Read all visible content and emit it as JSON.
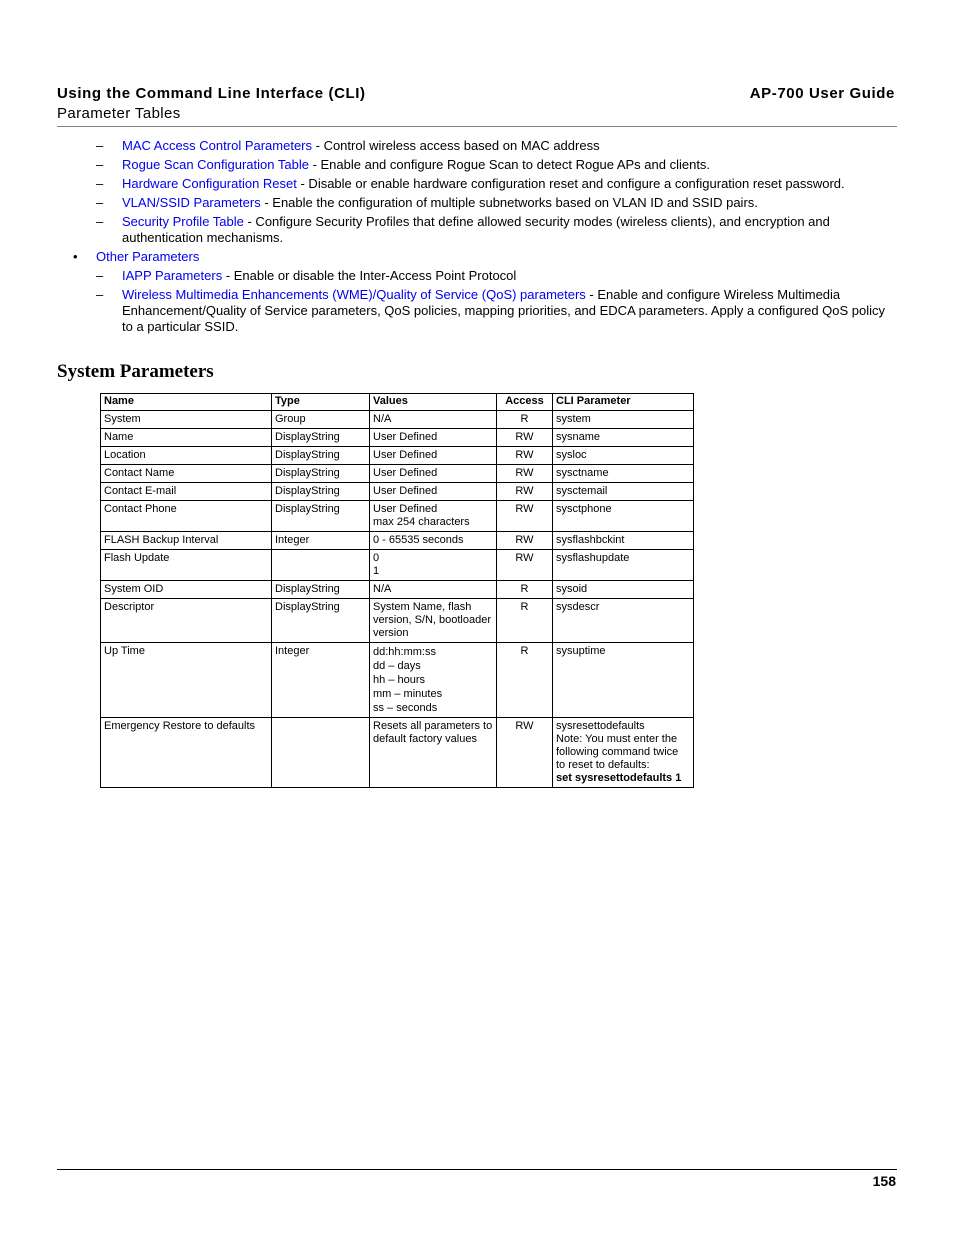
{
  "header": {
    "chapter_title": "Using the Command Line Interface (CLI)",
    "section": "Parameter Tables",
    "guide_title": "AP-700 User Guide"
  },
  "bullets": [
    {
      "marker": "–",
      "kind": "dash",
      "link": "MAC Access Control Parameters",
      "text": " - Control wireless access based on MAC address"
    },
    {
      "marker": "–",
      "kind": "dash",
      "link": "Rogue Scan Configuration Table",
      "text": " - Enable and configure Rogue Scan to detect Rogue APs and clients."
    },
    {
      "marker": "–",
      "kind": "dash",
      "link": "Hardware Configuration Reset",
      "text": " - Disable or enable hardware configuration reset and configure a configuration reset password."
    },
    {
      "marker": "–",
      "kind": "dash",
      "link": "VLAN/SSID Parameters",
      "text": " - Enable the configuration of multiple subnetworks based on VLAN ID and SSID pairs."
    },
    {
      "marker": "–",
      "kind": "dash",
      "link": "Security Profile Table",
      "text": " - Configure Security Profiles that define allowed security modes (wireless clients), and encryption and authentication mechanisms."
    },
    {
      "marker": "•",
      "kind": "dot",
      "link": "Other Parameters",
      "text": ""
    },
    {
      "marker": "–",
      "kind": "dash",
      "link": "IAPP Parameters",
      "text": " - Enable or disable the Inter-Access Point Protocol"
    },
    {
      "marker": "–",
      "kind": "dash",
      "link": "Wireless Multimedia Enhancements (WME)/Quality of Service (QoS) parameters",
      "text": " - Enable and configure Wireless Multimedia Enhancement/Quality of Service parameters, QoS policies, mapping priorities, and EDCA parameters. Apply a configured QoS policy to a particular SSID."
    }
  ],
  "section_title": "System Parameters",
  "table": {
    "headers": {
      "name": "Name",
      "type": "Type",
      "values": "Values",
      "access": "Access",
      "cli": "CLI Parameter"
    },
    "rows": [
      {
        "name": "System",
        "type": "Group",
        "values": [
          "N/A"
        ],
        "access": "R",
        "cli": "system"
      },
      {
        "name": "Name",
        "type": "DisplayString",
        "values": [
          "User Defined"
        ],
        "access": "RW",
        "cli": "sysname"
      },
      {
        "name": "Location",
        "type": "DisplayString",
        "values": [
          "User Defined"
        ],
        "access": "RW",
        "cli": "sysloc"
      },
      {
        "name": "Contact Name",
        "type": "DisplayString",
        "values": [
          "User Defined"
        ],
        "access": "RW",
        "cli": "sysctname"
      },
      {
        "name": "Contact E-mail",
        "type": "DisplayString",
        "values": [
          "User Defined"
        ],
        "access": "RW",
        "cli": "sysctemail"
      },
      {
        "name": "Contact Phone",
        "type": "DisplayString",
        "values": [
          "User Defined",
          "max 254 characters"
        ],
        "access": "RW",
        "cli": "sysctphone"
      },
      {
        "name": "FLASH Backup Interval",
        "type": "Integer",
        "values": [
          "0 - 65535 seconds"
        ],
        "access": "RW",
        "cli": "sysflashbckint"
      },
      {
        "name": "Flash Update",
        "type": "",
        "values": [
          "0",
          "1"
        ],
        "access": "RW",
        "cli": "sysflashupdate"
      },
      {
        "name": "System OID",
        "type": "DisplayString",
        "values": [
          "N/A"
        ],
        "access": "R",
        "cli": "sysoid"
      },
      {
        "name": "Descriptor",
        "type": "DisplayString",
        "values": [
          "System Name, flash version, S/N, bootloader version"
        ],
        "access": "R",
        "cli": "sysdescr"
      },
      {
        "name": "Up Time",
        "type": "Integer",
        "values": [
          "dd:hh:mm:ss",
          "dd – days",
          "hh – hours",
          "mm – minutes",
          "ss – seconds"
        ],
        "access": "R",
        "cli": "sysuptime"
      },
      {
        "name": "Emergency Restore to defaults",
        "type": "",
        "values": [
          "Resets all parameters to default factory values"
        ],
        "access": "RW",
        "cli": "sysresettodefaults",
        "cli_note": "Note: You must enter the following command twice to reset to defaults:",
        "cli_command": "set sysresettodefaults 1"
      }
    ]
  },
  "footer": {
    "page_number": "158"
  }
}
